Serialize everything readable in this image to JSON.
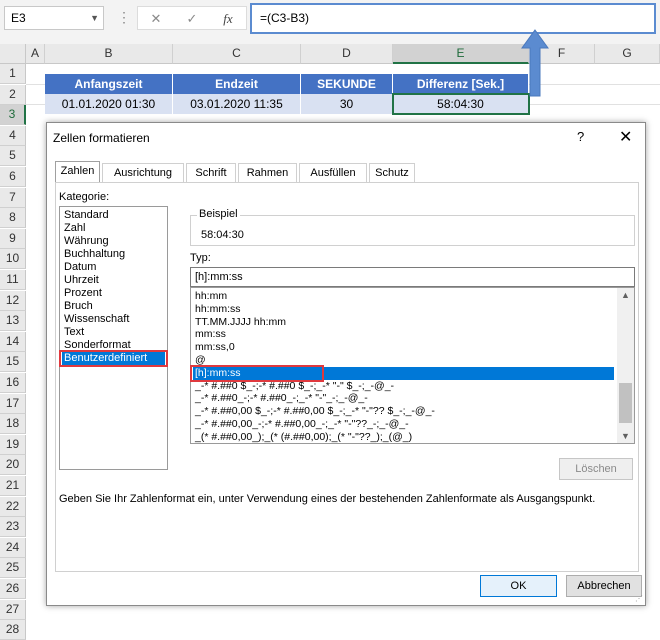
{
  "namebox": {
    "value": "E3"
  },
  "formula_bar": {
    "cancel_icon": "✕",
    "enter_icon": "✓",
    "fx_label": "fx",
    "formula": "=(C3-B3)"
  },
  "columns": [
    "A",
    "B",
    "C",
    "D",
    "E",
    "F",
    "G"
  ],
  "rows": [
    "1",
    "2",
    "3",
    "4",
    "5",
    "6",
    "7",
    "8",
    "9",
    "10",
    "11",
    "12",
    "13",
    "14",
    "15",
    "16",
    "17",
    "18",
    "19",
    "20",
    "21",
    "22",
    "23",
    "24",
    "25",
    "26",
    "27",
    "28"
  ],
  "table": {
    "headers": [
      "Anfangszeit",
      "Endzeit",
      "SEKUNDE",
      "Differenz [Sek.]"
    ],
    "row": [
      "01.01.2020 01:30",
      "03.01.2020 11:35",
      "30",
      "58:04:30"
    ]
  },
  "dialog": {
    "title": "Zellen formatieren",
    "help": "?",
    "close": "✕",
    "tabs": [
      "Zahlen",
      "Ausrichtung",
      "Schrift",
      "Rahmen",
      "Ausfüllen",
      "Schutz"
    ],
    "kategorie_label": "Kategorie:",
    "categories": [
      "Standard",
      "Zahl",
      "Währung",
      "Buchhaltung",
      "Datum",
      "Uhrzeit",
      "Prozent",
      "Bruch",
      "Wissenschaft",
      "Text",
      "Sonderformat",
      "Benutzerdefiniert"
    ],
    "selected_category": "Benutzerdefiniert",
    "beispiel_label": "Beispiel",
    "beispiel_value": "58:04:30",
    "typ_label": "Typ:",
    "typ_value": "[h]:mm:ss",
    "formats": [
      "hh:mm",
      "hh:mm:ss",
      "TT.MM.JJJJ hh:mm",
      "mm:ss",
      "mm:ss,0",
      "@",
      "[h]:mm:ss",
      "_-* #.##0 $_-;-* #.##0 $_-;_-* \"-\" $_-;_-@_-",
      "_-* #.##0_-;-* #.##0_-;_-* \"-\"_-;_-@_-",
      "_-* #.##0,00 $_-;-* #.##0,00 $_-;_-* \"-\"?? $_-;_-@_-",
      "_-* #.##0,00_-;-* #.##0,00_-;_-* \"-\"??_-;_-@_-",
      "_(* #.##0,00_);_(* (#.##0,00);_(* \"-\"??_);_(@_)"
    ],
    "selected_format": "[h]:mm:ss",
    "delete_button": "Löschen",
    "hint": "Geben Sie Ihr Zahlenformat ein, unter Verwendung eines der bestehenden Zahlenformate als Ausgangspunkt.",
    "ok_button": "OK",
    "cancel_button": "Abbrechen"
  },
  "colors": {
    "header_blue": "#4472c4",
    "data_blue": "#d9e1f2",
    "excel_green": "#217346",
    "highlight_red": "#e0393e",
    "callout_blue": "#5b8bd0",
    "selection": "#0078d7"
  }
}
